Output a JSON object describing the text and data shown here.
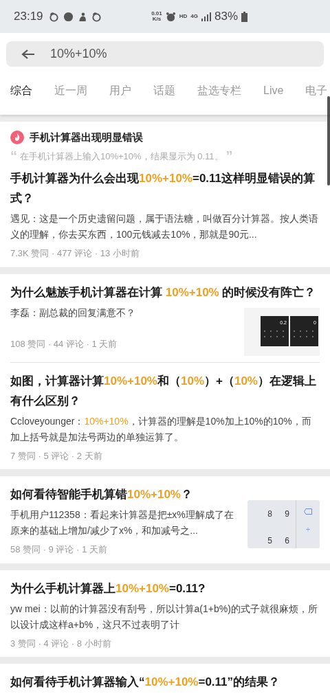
{
  "status_bar": {
    "time": "23:19",
    "net_speed": "0.01",
    "net_unit": "K/s",
    "hd": "HD",
    "network": "4G",
    "battery": "83%"
  },
  "search": {
    "value": "10%+10%"
  },
  "tabs": [
    {
      "label": "综合",
      "selected": true
    },
    {
      "label": "近一周",
      "selected": false
    },
    {
      "label": "用户",
      "selected": false
    },
    {
      "label": "话题",
      "selected": false
    },
    {
      "label": "盐选专栏",
      "selected": false
    },
    {
      "label": "Live",
      "selected": false
    },
    {
      "label": "电子",
      "selected": false
    }
  ],
  "results": [
    {
      "topic": {
        "title": "手机计算器出现明显错误",
        "open_quote": "“",
        "quote": "在手机计算器上输入10%+10%，结果显示为 0.11。",
        "close_quote": "”"
      },
      "title": [
        {
          "text": "手机计算器为什么会出现",
          "highlight": false
        },
        {
          "text": "10%+10%",
          "highlight": true
        },
        {
          "text": "=0.11这样明显错误的算式？",
          "highlight": false
        }
      ],
      "excerpt": [
        {
          "text": "遇见：这是一个历史遗留问题，属于语法糖，叫做百分计算器。按人类语义的理解，你去买东西，100元钱减去10%，那就是90元...",
          "highlight": false
        }
      ],
      "meta": "7.3K 赞同 · 477 评论 · 13 小时前"
    },
    {
      "line_below": true,
      "title": [
        {
          "text": "为什么魅族手机计算器在计算 ",
          "highlight": false
        },
        {
          "text": "10%+10%",
          "highlight": true
        },
        {
          "text": " 的时候没有阵亡？",
          "highlight": false
        }
      ],
      "excerpt": [
        {
          "text": "李磊：副总裁的回复满意不？",
          "highlight": false
        }
      ],
      "meta": "108 赞同 · 44 评论 · 1 天前",
      "thumbnail": {
        "kind": "calculator_screens",
        "displays": [
          "0.2",
          "0"
        ]
      }
    },
    {
      "title": [
        {
          "text": "如图，计算器计算",
          "highlight": false
        },
        {
          "text": "10%+10%",
          "highlight": true
        },
        {
          "text": "和（",
          "highlight": false
        },
        {
          "text": "10%",
          "highlight": true
        },
        {
          "text": "）+（",
          "highlight": false
        },
        {
          "text": "10%",
          "highlight": true
        },
        {
          "text": "）在逻辑上有什么区别？",
          "highlight": false
        }
      ],
      "excerpt": [
        {
          "text": "Ccloveyounger：",
          "highlight": false
        },
        {
          "text": "10%+10%",
          "highlight": true
        },
        {
          "text": "，计算器的理解是10%加上10%的10%，而加上括号就是加法号两边的单独运算了。",
          "highlight": false
        }
      ],
      "meta": "7 赞同 · 5 评论 · 2 天前"
    },
    {
      "title": [
        {
          "text": "如何看待智能手机算错",
          "highlight": false
        },
        {
          "text": "10%+10%",
          "highlight": true
        },
        {
          "text": "？",
          "highlight": false
        }
      ],
      "excerpt": [
        {
          "text": "手机用户112358：看起来计算器是把±x%理解成了在原来的基础上增加/减少了x%，和加减号之...",
          "highlight": false
        }
      ],
      "meta": "58 赞同 · 9 评论 · 1 天前",
      "thumbnail": {
        "kind": "keypad",
        "keys": [
          "8",
          "9",
          "5",
          "6"
        ],
        "side_key": "÷"
      }
    },
    {
      "title": [
        {
          "text": "为什么手机计算器上",
          "highlight": false
        },
        {
          "text": "10%+10%",
          "highlight": true
        },
        {
          "text": "=0.11?",
          "highlight": false
        }
      ],
      "excerpt": [
        {
          "text": "yw mei：以前的计算器没有刮号，所以计算a(1+b%)的式子就很麻烦，所以设计成这样a+b%，这只不过表明了计",
          "highlight": false
        }
      ],
      "meta": "3 赞同 · 4 评论 · 8 小时前"
    },
    {
      "title": [
        {
          "text": "如何看待手机计算器输入“",
          "highlight": false
        },
        {
          "text": "10%+10%",
          "highlight": true
        },
        {
          "text": "=0.11”的结果？",
          "highlight": false
        }
      ]
    }
  ]
}
